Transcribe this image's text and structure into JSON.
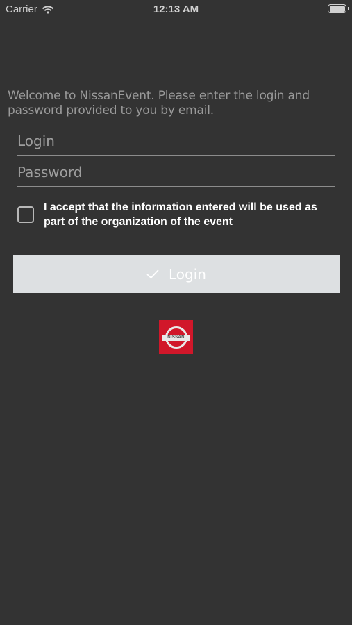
{
  "status_bar": {
    "carrier": "Carrier",
    "time": "12:13 AM",
    "battery_level": 1.0,
    "icons": [
      "wifi-icon",
      "battery-icon"
    ]
  },
  "welcome_text": "Welcome to NissanEvent. Please enter the login and password provided to you by email.",
  "form": {
    "login_placeholder": "Login",
    "login_value": "",
    "password_placeholder": "Password",
    "password_value": "",
    "consent_label": "I accept that the information entered will be used as part of the organization of the event",
    "consent_checked": false,
    "submit_label": "Login",
    "submit_icon": "checkmark-icon"
  },
  "logo": {
    "brand": "NISSAN",
    "icon": "nissan-logo-icon"
  },
  "colors": {
    "background": "#333333",
    "button": "#dde0e2",
    "brand_red": "#d1172a",
    "muted_text": "#9a9a9a"
  }
}
